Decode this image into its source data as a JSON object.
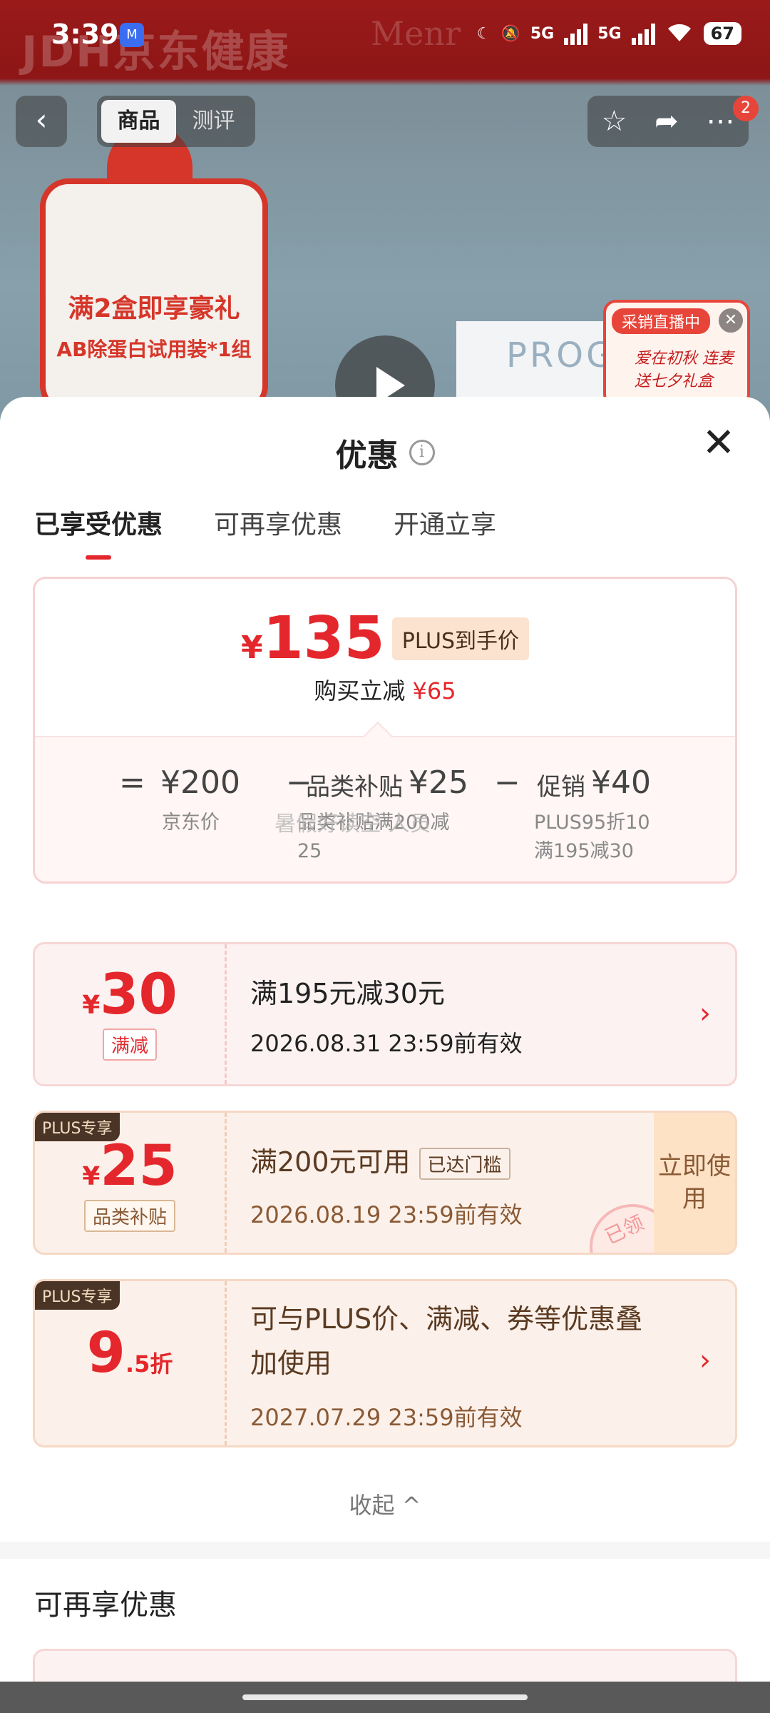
{
  "status_bar": {
    "time": "3:39",
    "app_badge": "M",
    "network": "5G",
    "network2": "5G",
    "battery": "67"
  },
  "background": {
    "brand": "JDH京东健康",
    "brand2": "Menr",
    "promo_line1": "满2盒即享豪礼",
    "promo_line2": "AB除蛋白试用装*1组",
    "product_text": "PROGE",
    "live_tag": "采销直播中",
    "live_text": "爱在初秋 连麦送七夕礼盒"
  },
  "top_nav": {
    "back_icon": "chevron-left",
    "segments": [
      "商品",
      "测评"
    ],
    "active_segment": "商品",
    "badge_count": "2"
  },
  "sheet": {
    "title": "优惠",
    "info_glyph": "i",
    "close_glyph": "✕",
    "tabs": [
      "已享受优惠",
      "可再享优惠",
      "开通立享"
    ],
    "active_tab": "已享受优惠",
    "summary": {
      "currency": "¥",
      "final_price": "135",
      "plus_label": "PLUS到手价",
      "discount_prefix": "购买立减",
      "discount_value": "¥65",
      "equals": "=",
      "minus": "−",
      "jd_price": "¥200",
      "jd_price_label": "京东价",
      "subsidy_label": "品类补贴",
      "subsidy_value": "¥25",
      "subsidy_desc_1": "品类补贴满200减",
      "subsidy_desc_2": "25",
      "promo_label": "促销",
      "promo_value": "¥40",
      "promo_desc_1": "PLUS95折10",
      "promo_desc_2": "满195减30",
      "overlay_text": "暑假好读空·人员"
    },
    "coupons": [
      {
        "currency": "¥",
        "amount": "30",
        "tag": "满减",
        "title": "满195元减30元",
        "validity": "2026.08.31 23:59前有效"
      },
      {
        "plus_badge": "PLUS专享",
        "currency": "¥",
        "amount": "25",
        "tag": "品类补贴",
        "title": "满200元可用",
        "status_chip": "已达门槛",
        "validity": "2026.08.19 23:59前有效",
        "use_button": "立即使用",
        "stamp": "已领"
      },
      {
        "plus_badge": "PLUS专享",
        "amount": "9",
        "amount_suffix": ".5折",
        "title_line1": "可与PLUS价、满减、券等优惠叠",
        "title_line2": "加使用",
        "validity": "2027.07.29 23:59前有效"
      }
    ],
    "collapse_label": "收起",
    "collapse_glyph": "^",
    "more_section_title": "可再享优惠"
  },
  "colors": {
    "accent_red": "#e4272c",
    "plus_brown": "#4a3426",
    "plus_bg": "#fbe3cf"
  }
}
